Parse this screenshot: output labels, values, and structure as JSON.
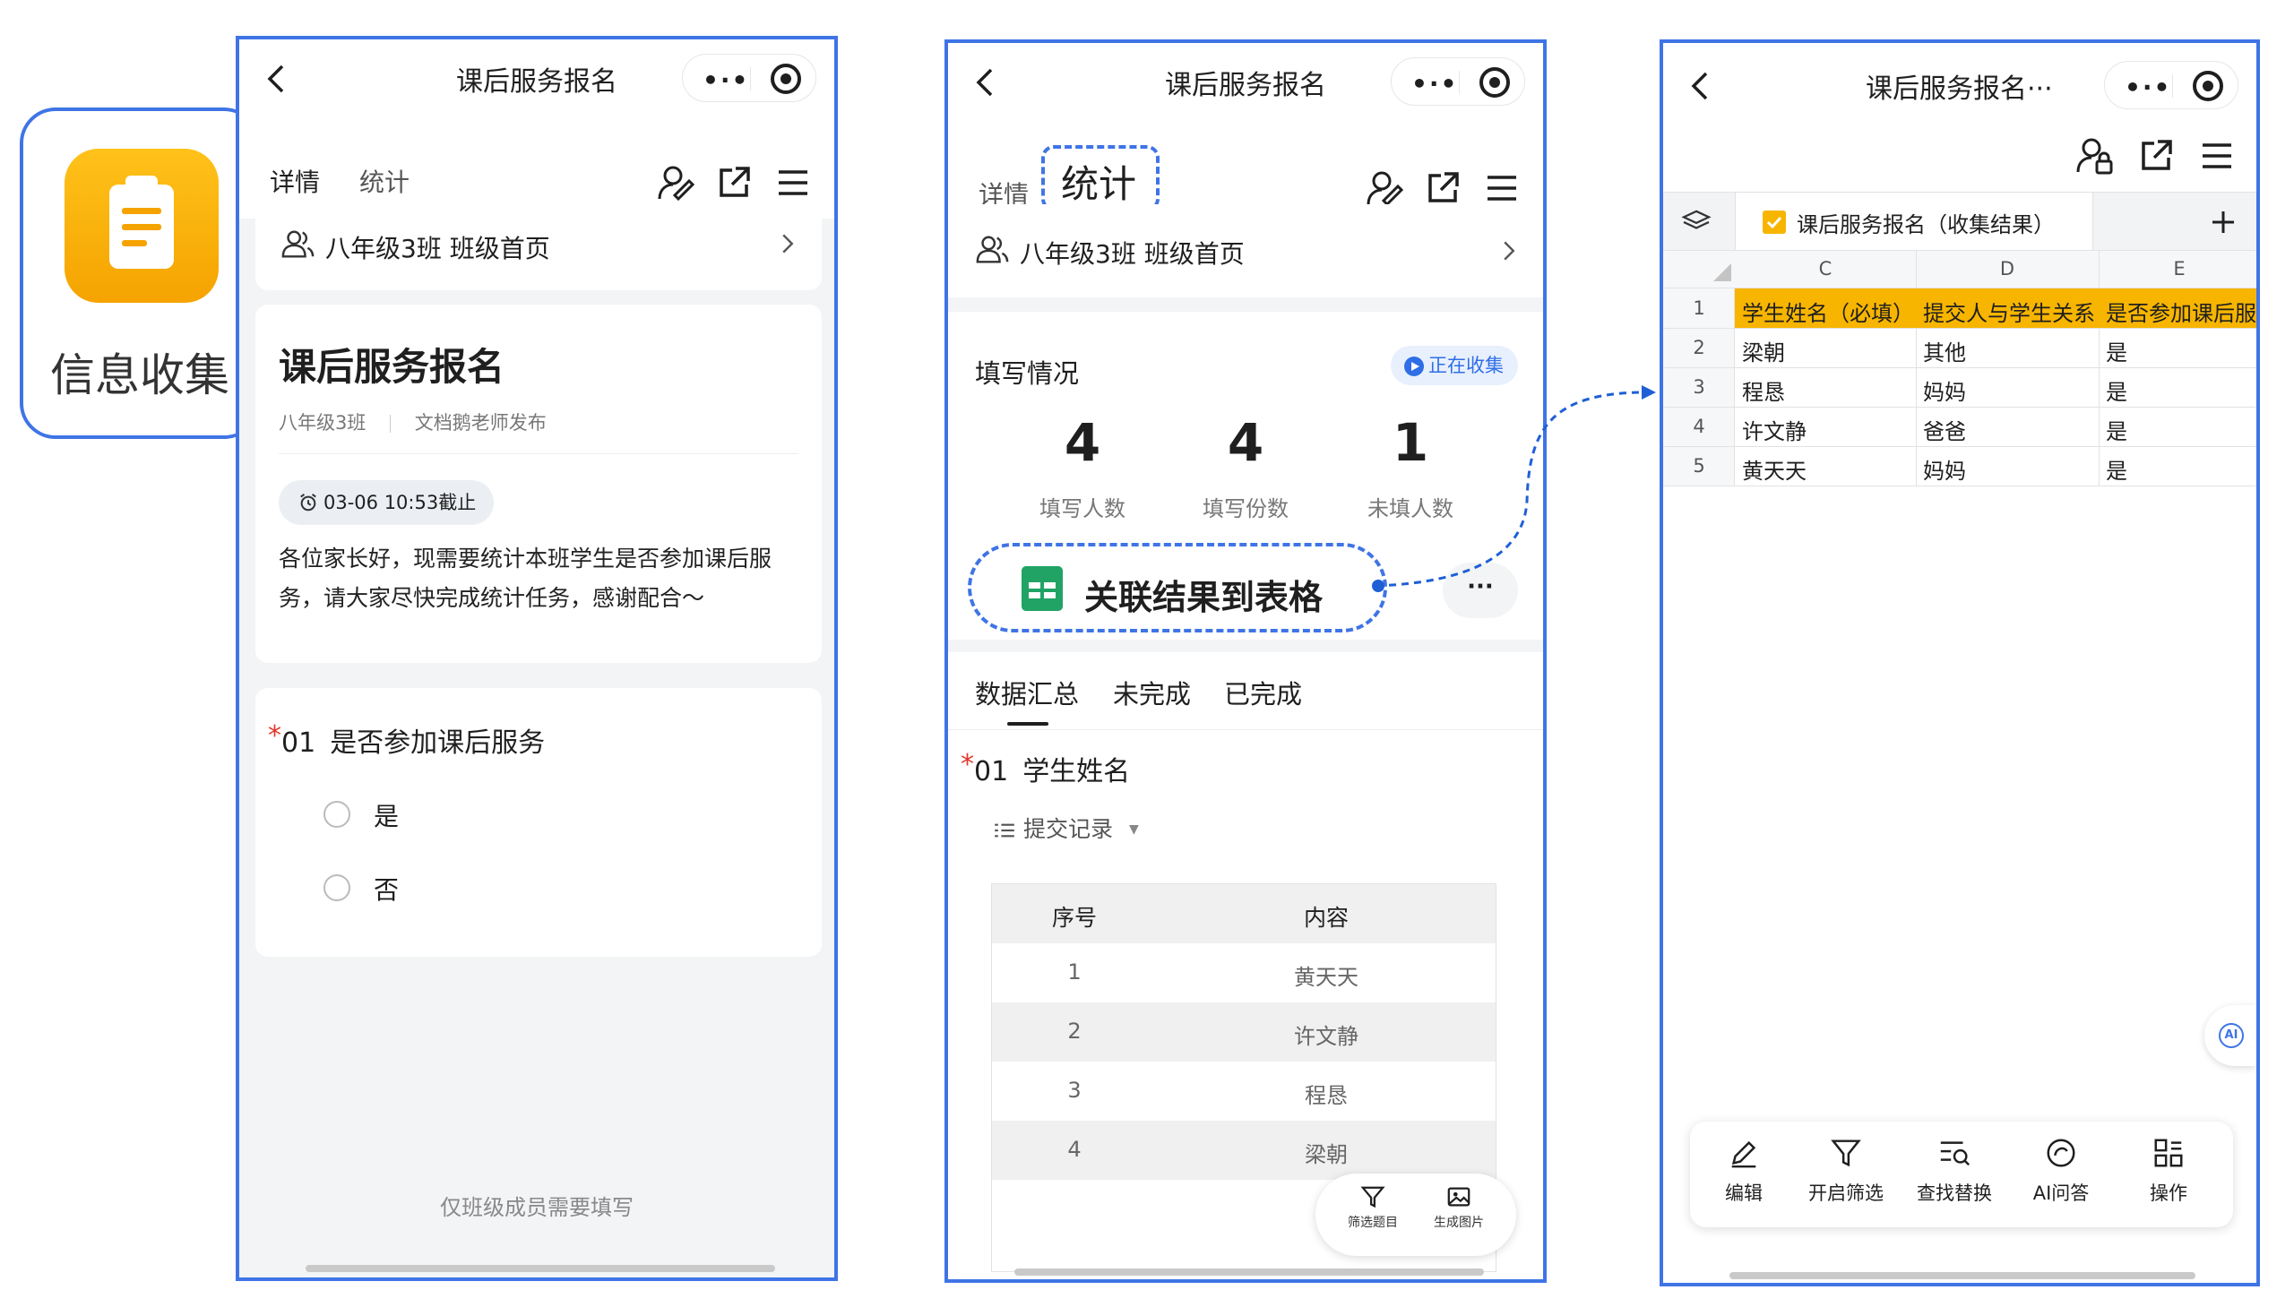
{
  "app_icon": {
    "label": "信息收集",
    "accent": "#f7b500"
  },
  "phone1": {
    "nav_title": "课后服务报名",
    "tabs": [
      "详情",
      "统计"
    ],
    "class_link": "八年级3班 班级首页",
    "form_title": "课后服务报名",
    "class_name": "八年级3班",
    "publisher": "文档鹅老师发布",
    "deadline": "03-06 10:53截止",
    "description": "各位家长好，现需要统计本班学生是否参加课后服务，请大家尽快完成统计任务，感谢配合～",
    "question": {
      "required_mark": "*",
      "number": "01",
      "text": "是否参加课后服务",
      "options": [
        "是",
        "否"
      ]
    },
    "footer_note": "仅班级成员需要填写"
  },
  "phone2": {
    "nav_title": "课后服务报名",
    "tabs": [
      "详情",
      "统计"
    ],
    "class_link": "八年级3班 班级首页",
    "section_title": "填写情况",
    "status_badge": "正在收集",
    "stats": [
      {
        "value": "4",
        "label": "填写人数"
      },
      {
        "value": "4",
        "label": "填写份数"
      },
      {
        "value": "1",
        "label": "未填人数"
      }
    ],
    "link_button": "关联结果到表格",
    "more": "···",
    "sub_tabs": [
      "数据汇总",
      "未完成",
      "已完成"
    ],
    "question": {
      "required_mark": "*",
      "number": "01",
      "text": "学生姓名"
    },
    "records_label": "提交记录",
    "table": {
      "headers": [
        "序号",
        "内容"
      ],
      "rows": [
        [
          "1",
          "黄天天"
        ],
        [
          "2",
          "许文静"
        ],
        [
          "3",
          "程恳"
        ],
        [
          "4",
          "梁朝"
        ]
      ]
    },
    "float_actions": [
      "筛选题目",
      "生成图片"
    ]
  },
  "phone3": {
    "nav_title": "课后服务报名···",
    "sheet_tab": "课后服务报名（收集结果）",
    "columns": [
      "C",
      "D",
      "E"
    ],
    "row_numbers": [
      "1",
      "2",
      "3",
      "4",
      "5"
    ],
    "header_row": [
      "学生姓名（必填）",
      "提交人与学生关系",
      "是否参加课后服"
    ],
    "rows": [
      [
        "梁朝",
        "其他",
        "是"
      ],
      [
        "程恳",
        "妈妈",
        "是"
      ],
      [
        "许文静",
        "爸爸",
        "是"
      ],
      [
        "黄天天",
        "妈妈",
        "是"
      ]
    ],
    "ai_badge": "AI",
    "toolbar": [
      "编辑",
      "开启筛选",
      "查找替换",
      "AI问答",
      "操作"
    ],
    "header_color": "#f7b500"
  }
}
